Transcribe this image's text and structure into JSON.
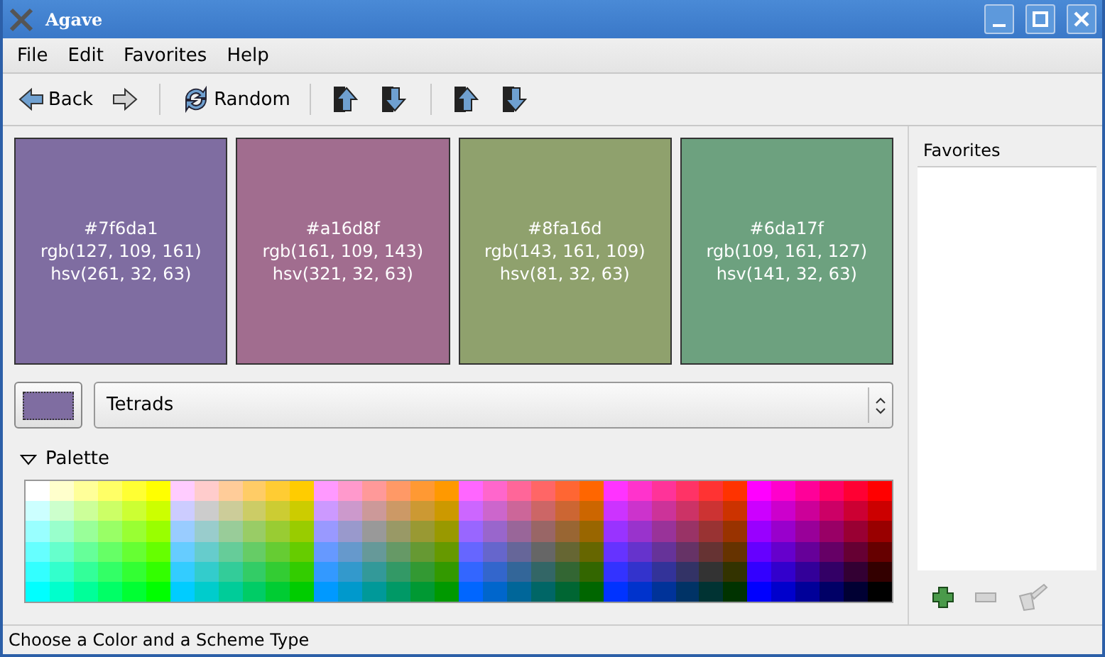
{
  "window": {
    "title": "Agave"
  },
  "menu": [
    {
      "label": "File"
    },
    {
      "label": "Edit"
    },
    {
      "label": "Favorites"
    },
    {
      "label": "Help"
    }
  ],
  "toolbar": [
    {
      "kind": "back",
      "label": "Back",
      "disabled": false
    },
    {
      "kind": "forward",
      "disabled": true
    },
    {
      "kind": "separator"
    },
    {
      "kind": "random",
      "label": "Random",
      "disabled": false
    },
    {
      "kind": "separator"
    },
    {
      "kind": "lighter",
      "disabled": false
    },
    {
      "kind": "darker",
      "disabled": false
    },
    {
      "kind": "separator"
    },
    {
      "kind": "saturate",
      "disabled": false
    },
    {
      "kind": "desaturate",
      "disabled": false
    }
  ],
  "swatches": [
    {
      "color": "#7f6da1",
      "hex": "#7f6da1",
      "rgb": "rgb(127, 109, 161)",
      "hsv": "hsv(261, 32, 63)"
    },
    {
      "color": "#a16d8f",
      "hex": "#a16d8f",
      "rgb": "rgb(161, 109, 143)",
      "hsv": "hsv(321, 32, 63)"
    },
    {
      "color": "#8fa16d",
      "hex": "#8fa16d",
      "rgb": "rgb(143, 161, 109)",
      "hsv": "hsv(81, 32, 63)"
    },
    {
      "color": "#6da17f",
      "hex": "#6da17f",
      "rgb": "rgb(109, 161, 127)",
      "hsv": "hsv(141, 32, 63)"
    }
  ],
  "current_color": {
    "color": "#7f6da1"
  },
  "scheme": {
    "value": "Tetrads"
  },
  "palette": {
    "label": "Palette",
    "expanded": true
  },
  "favorites": {
    "header": "Favorites",
    "buttons": [
      {
        "kind": "add",
        "disabled": false
      },
      {
        "kind": "remove",
        "disabled": true
      },
      {
        "kind": "clear",
        "disabled": true
      }
    ]
  },
  "status_bar": "Choose a Color and a Scheme Type"
}
